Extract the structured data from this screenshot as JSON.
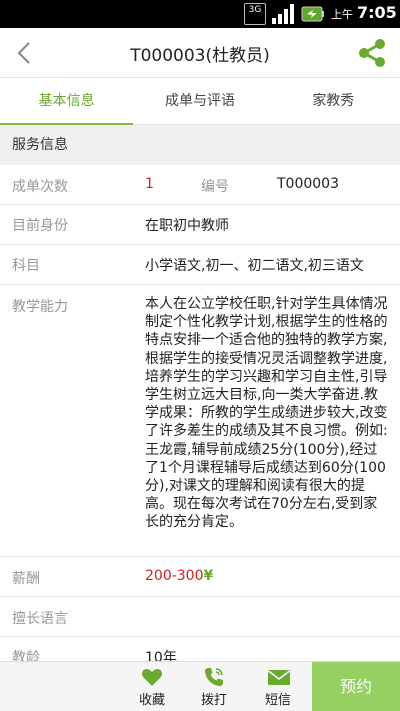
{
  "status_bar": {
    "network": "3G",
    "ampm": "上午",
    "time": "7:05"
  },
  "header": {
    "title": "T000003(杜教员)",
    "back_icon": "chevron-left-icon",
    "share_icon": "share-icon"
  },
  "tabs": [
    {
      "label": "基本信息",
      "active": true
    },
    {
      "label": "成单与评语",
      "active": false
    },
    {
      "label": "家教秀",
      "active": false
    }
  ],
  "section": {
    "title": "服务信息"
  },
  "fields": {
    "order_count": {
      "label": "成单次数",
      "value": "1"
    },
    "number": {
      "label": "编号",
      "value": "T000003"
    },
    "identity": {
      "label": "目前身份",
      "value": "在职初中教师"
    },
    "subjects": {
      "label": "科目",
      "value": "小学语文,初一、初二语文,初三语文"
    },
    "ability": {
      "label": "教学能力",
      "value": "本人在公立学校任职,针对学生具体情况制定个性化教学计划,根据学生的性格的特点安排一个适合他的独特的教学方案,根据学生的接受情况灵活调整教学进度,培养学生的学习兴趣和学习自主性,引导学生树立远大目标,向一类大学奋进.教学成果：所教的学生成绩进步较大,改变了许多差生的成绩及其不良习惯。例如:王龙霞,辅导前成绩25分(100分),经过了1个月课程辅导后成绩达到60分(100分),对课文的理解和阅读有很大的提高。现在每次考试在70分左右,受到家长的充分肯定。"
    },
    "salary": {
      "label": "薪酬",
      "value": "200-300",
      "unit": "¥"
    },
    "language": {
      "label": "擅长语言",
      "value": ""
    },
    "teaching_age": {
      "label": "教龄",
      "value": "10年"
    }
  },
  "bottom_bar": {
    "favorite": {
      "label": "收藏",
      "icon": "heart-icon"
    },
    "call": {
      "label": "拨打",
      "icon": "phone-icon"
    },
    "sms": {
      "label": "短信",
      "icon": "envelope-icon"
    },
    "book": {
      "label": "预约"
    }
  },
  "colors": {
    "accent_green": "#7bbf35",
    "red_value": "#d42020",
    "book_button": "#96cf62"
  }
}
